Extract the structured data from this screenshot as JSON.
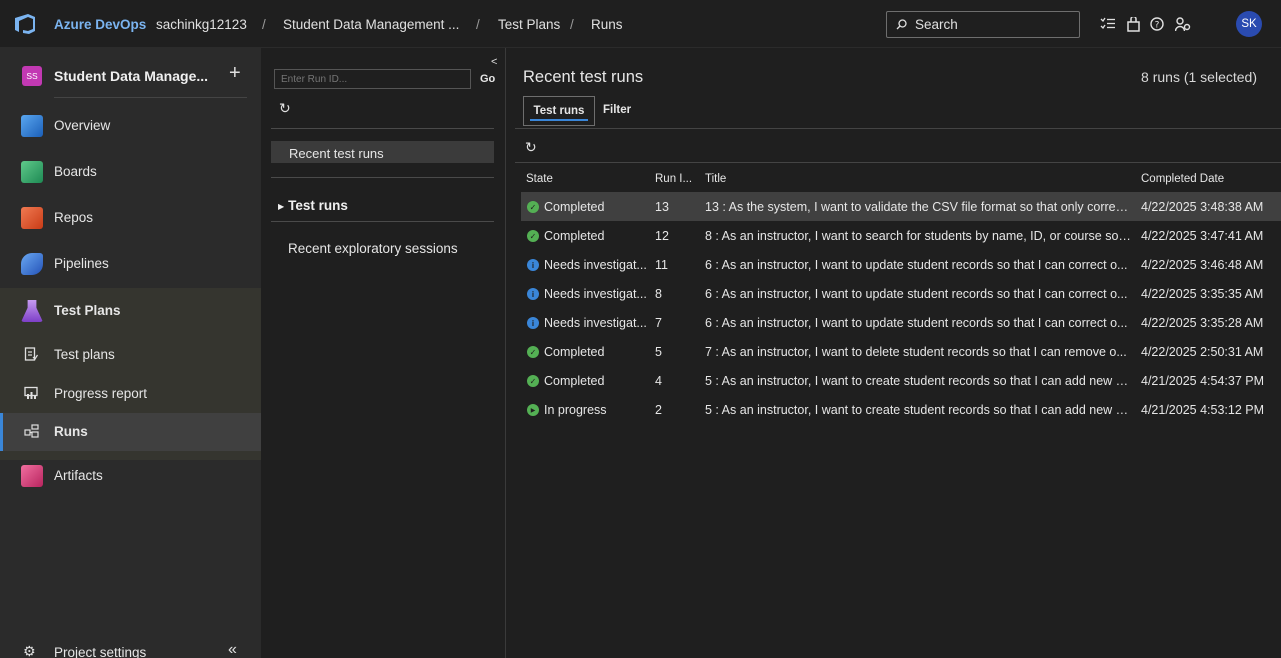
{
  "header": {
    "brand": "Azure DevOps",
    "org": "sachinkg12123",
    "sep": "/",
    "crumbs": [
      "Student Data Management ...",
      "Test Plans",
      "Runs"
    ],
    "search_label": "Search",
    "avatar": "SK"
  },
  "sidebar": {
    "project_badge": "SS",
    "project_name": "Student Data Manage...",
    "project_plus": "+",
    "items": [
      {
        "label": "Overview",
        "color": "#2f7ad8"
      },
      {
        "label": "Boards",
        "color": "#2fa56a"
      },
      {
        "label": "Repos",
        "color": "#e0542b"
      },
      {
        "label": "Pipelines",
        "color": "#3a7fd8"
      },
      {
        "label": "Test Plans",
        "color": "#9a57d6"
      },
      {
        "label": "Artifacts",
        "color": "#c8346e"
      }
    ],
    "sub_items": [
      {
        "label": "Test plans"
      },
      {
        "label": "Progress report"
      },
      {
        "label": "Runs"
      }
    ],
    "settings_label": "Project settings"
  },
  "mid": {
    "runid_placeholder": "Enter Run ID...",
    "go_label": "Go",
    "recent_label": "Recent test runs",
    "tree_runs_label": "Test runs",
    "recent_exploratory_label": "Recent exploratory sessions"
  },
  "main": {
    "title": "Recent test runs",
    "count": "8 runs (1 selected)",
    "tabs": [
      "Test runs",
      "Filter"
    ],
    "columns": [
      "State",
      "Run I...",
      "Title",
      "Completed Date"
    ],
    "rows": [
      {
        "state": "Completed",
        "status": "completed",
        "run": "13",
        "title": "13 : As the system, I want to validate the CSV file format so that only correc...",
        "date": "4/22/2025 3:48:38 AM",
        "selected": true
      },
      {
        "state": "Completed",
        "status": "completed",
        "run": "12",
        "title": "8 : As an instructor, I want to search for students by name, ID, or course so ...",
        "date": "4/22/2025 3:47:41 AM",
        "selected": false
      },
      {
        "state": "Needs investigat...",
        "status": "info",
        "run": "11",
        "title": "6 : As an instructor, I want to update student records so that I can correct o...",
        "date": "4/22/2025 3:46:48 AM",
        "selected": false
      },
      {
        "state": "Needs investigat...",
        "status": "info",
        "run": "8",
        "title": "6 : As an instructor, I want to update student records so that I can correct o...",
        "date": "4/22/2025 3:35:35 AM",
        "selected": false
      },
      {
        "state": "Needs investigat...",
        "status": "info",
        "run": "7",
        "title": "6 : As an instructor, I want to update student records so that I can correct o...",
        "date": "4/22/2025 3:35:28 AM",
        "selected": false
      },
      {
        "state": "Completed",
        "status": "completed",
        "run": "5",
        "title": "7 : As an instructor, I want to delete student records so that I can remove o...",
        "date": "4/22/2025 2:50:31 AM",
        "selected": false
      },
      {
        "state": "Completed",
        "status": "completed",
        "run": "4",
        "title": "5 : As an instructor, I want to create student records so that I can add new s...",
        "date": "4/21/2025 4:54:37 PM",
        "selected": false
      },
      {
        "state": "In progress",
        "status": "progress",
        "run": "2",
        "title": "5 : As an instructor, I want to create student records so that I can add new s...",
        "date": "4/21/2025 4:53:12 PM",
        "selected": false
      }
    ]
  },
  "colors": {
    "completed": "#54b054",
    "info": "#3a86d8",
    "progress": "#54b054",
    "accent": "#3a86d8"
  }
}
